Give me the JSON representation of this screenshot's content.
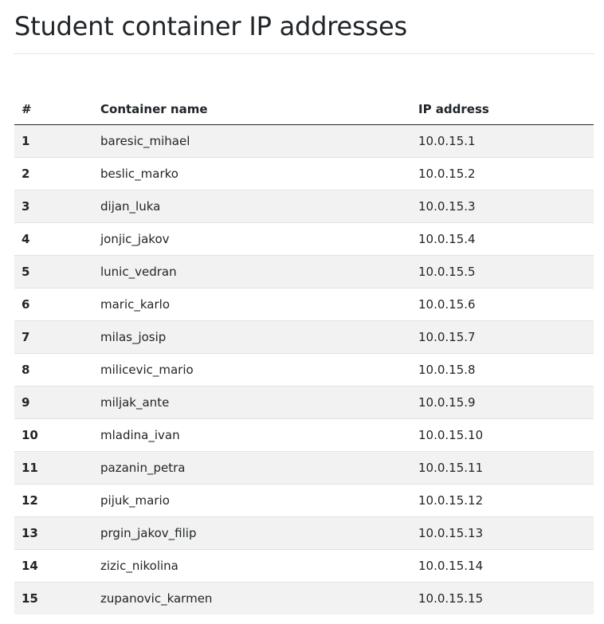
{
  "page": {
    "title": "Student container IP addresses"
  },
  "table": {
    "headers": {
      "num": "#",
      "name": "Container name",
      "ip": "IP address"
    },
    "rows": [
      {
        "num": "1",
        "name": "baresic_mihael",
        "ip": "10.0.15.1"
      },
      {
        "num": "2",
        "name": "beslic_marko",
        "ip": "10.0.15.2"
      },
      {
        "num": "3",
        "name": "dijan_luka",
        "ip": "10.0.15.3"
      },
      {
        "num": "4",
        "name": "jonjic_jakov",
        "ip": "10.0.15.4"
      },
      {
        "num": "5",
        "name": "lunic_vedran",
        "ip": "10.0.15.5"
      },
      {
        "num": "6",
        "name": "maric_karlo",
        "ip": "10.0.15.6"
      },
      {
        "num": "7",
        "name": "milas_josip",
        "ip": "10.0.15.7"
      },
      {
        "num": "8",
        "name": "milicevic_mario",
        "ip": "10.0.15.8"
      },
      {
        "num": "9",
        "name": "miljak_ante",
        "ip": "10.0.15.9"
      },
      {
        "num": "10",
        "name": "mladina_ivan",
        "ip": "10.0.15.10"
      },
      {
        "num": "11",
        "name": "pazanin_petra",
        "ip": "10.0.15.11"
      },
      {
        "num": "12",
        "name": "pijuk_mario",
        "ip": "10.0.15.12"
      },
      {
        "num": "13",
        "name": "prgin_jakov_filip",
        "ip": "10.0.15.13"
      },
      {
        "num": "14",
        "name": "zizic_nikolina",
        "ip": "10.0.15.14"
      },
      {
        "num": "15",
        "name": "zupanovic_karmen",
        "ip": "10.0.15.15"
      }
    ]
  }
}
